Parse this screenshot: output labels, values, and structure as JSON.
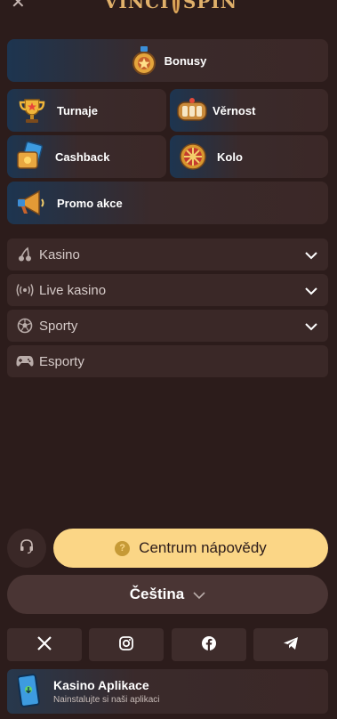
{
  "header": {
    "close_glyph": "✕",
    "logo_left": "VINCI",
    "logo_right": "SPIN"
  },
  "promos": {
    "bonusy": "Bonusy",
    "turnaje": "Turnaje",
    "vernost": "Věrnost",
    "cashback": "Cashback",
    "kolo": "Kolo",
    "promo_akce": "Promo akce"
  },
  "nav": {
    "kasino": "Kasino",
    "live_kasino": "Live kasino",
    "sporty": "Sporty",
    "esporty": "Esporty"
  },
  "help": {
    "label": "Centrum nápovědy",
    "icon_glyph": "?"
  },
  "language": {
    "label": "Čeština"
  },
  "social": [
    "x-icon",
    "instagram-icon",
    "facebook-icon",
    "telegram-icon"
  ],
  "app": {
    "title": "Kasino Aplikace",
    "subtitle": "Nainstalujte si naši aplikaci"
  },
  "colors": {
    "background": "#2c1c1b",
    "tile": "#3a2827",
    "help_yellow": "#fbd686",
    "promo_blue": "#1d3550"
  }
}
